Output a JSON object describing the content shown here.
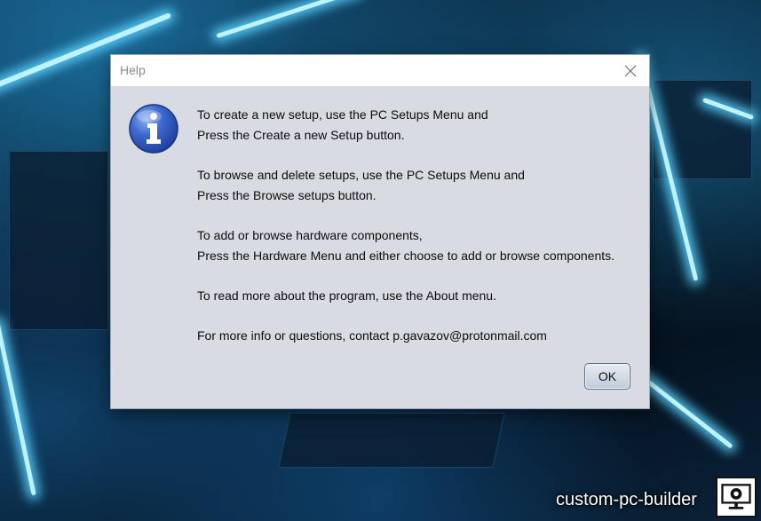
{
  "dialog": {
    "title": "Help",
    "close_icon": "close-icon",
    "info_icon": "info-icon",
    "paragraphs": [
      [
        "To create a new setup, use the PC Setups Menu and",
        "Press the Create a new Setup button."
      ],
      [
        "To browse and delete setups, use the PC Setups Menu and",
        "Press the Browse setups button."
      ],
      [
        "To add or browse hardware components,",
        "Press the Hardware Menu and either choose to add or browse components."
      ],
      [
        "To read more about the program, use the About menu."
      ],
      [
        "For more info or questions, contact p.gavazov@protonmail.com"
      ]
    ],
    "ok_label": "OK"
  },
  "branding": {
    "text": "custom-pc-builder",
    "logo_icon": "gear-computer-logo-icon"
  },
  "colors": {
    "dialog_bg": "#d8dbe2",
    "titlebar_bg": "#ffffff",
    "info_blue": "#2f57b8",
    "accent_cyan": "#5ad2ff"
  }
}
